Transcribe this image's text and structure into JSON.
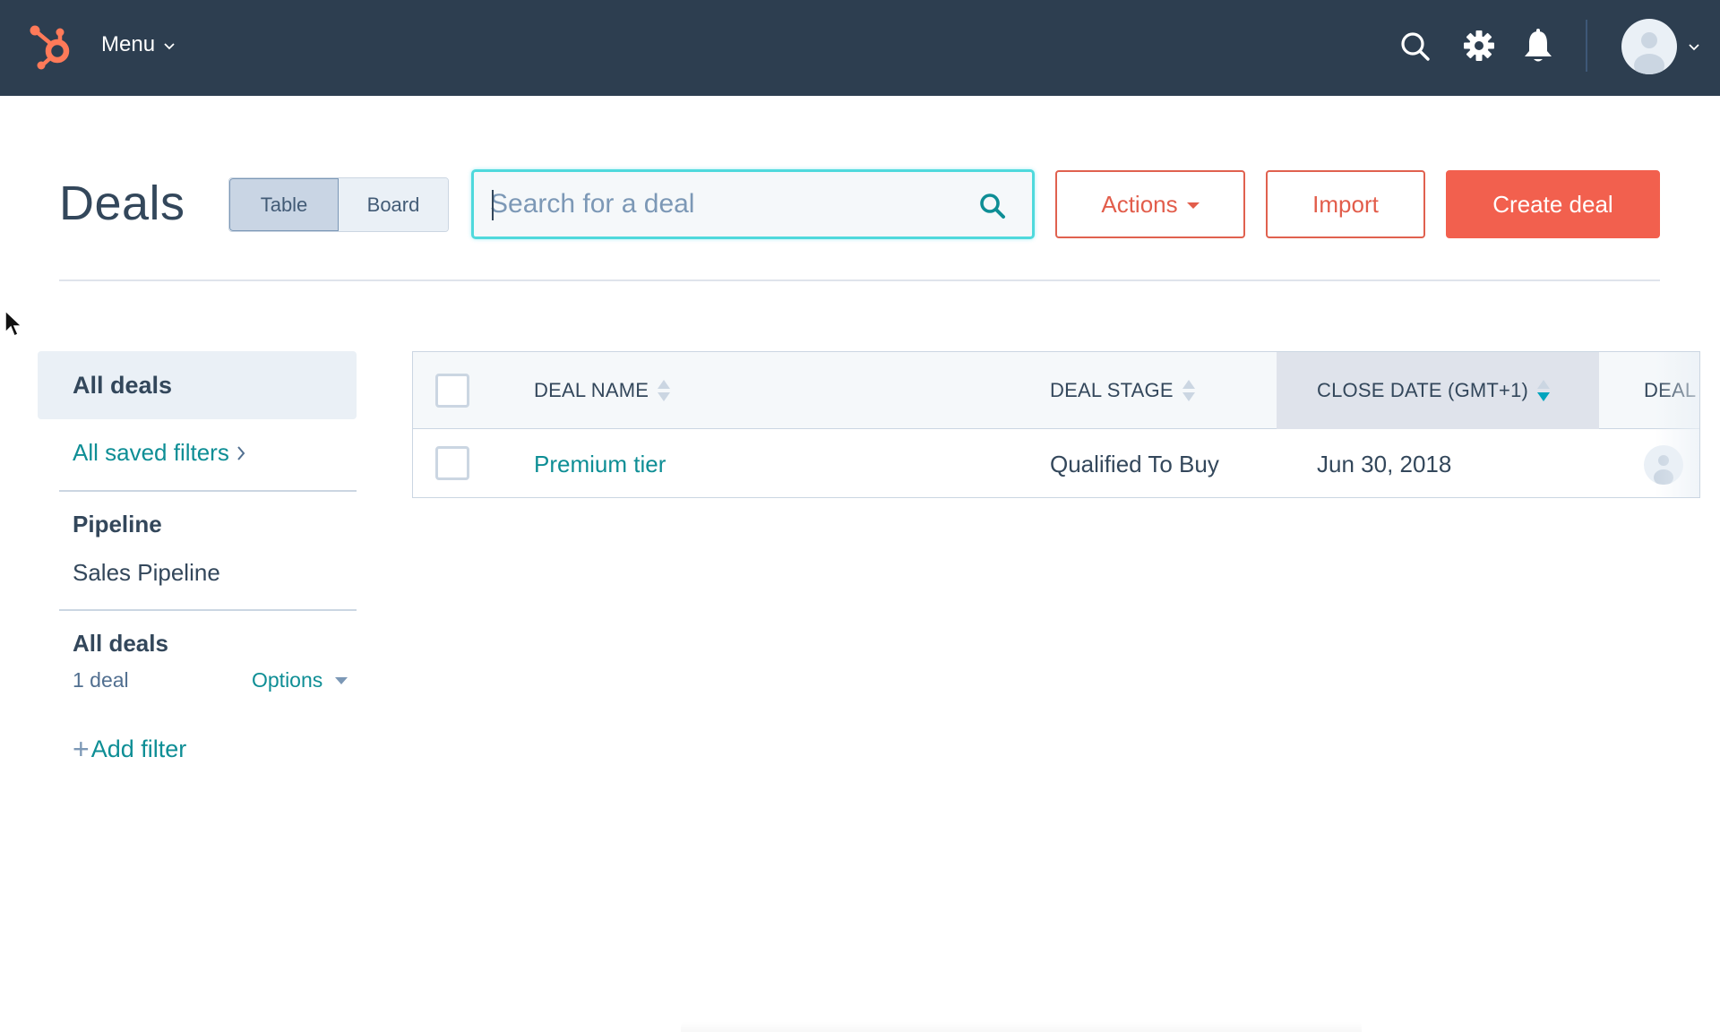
{
  "nav": {
    "logo_icon": "hubspot-sprocket-icon",
    "menu_label": "Menu",
    "icons": [
      "search-icon",
      "gear-icon",
      "bell-icon"
    ],
    "avatar_icon": "user-avatar-icon",
    "brand_color": "#ff7a59",
    "bg_color": "#2d3e50"
  },
  "page": {
    "title": "Deals",
    "view_toggle": [
      {
        "label": "Table",
        "active": true
      },
      {
        "label": "Board",
        "active": false
      }
    ],
    "search": {
      "placeholder": "Search for a deal",
      "value": ""
    },
    "buttons": {
      "actions": "Actions",
      "import": "Import",
      "create": "Create deal"
    },
    "accent_color": "#f2604e",
    "link_color": "#0e8e95"
  },
  "sidebar": {
    "active_view": "All deals",
    "saved_filters": "All saved filters",
    "pipeline_label": "Pipeline",
    "pipeline_value": "Sales Pipeline",
    "current_view_label": "All deals",
    "deal_count": "1 deal",
    "options_label": "Options",
    "add_filter": "Add filter",
    "add_filter_prefix": "+"
  },
  "table": {
    "columns": [
      {
        "label": "DEAL NAME",
        "sort": "none"
      },
      {
        "label": "DEAL STAGE",
        "sort": "none"
      },
      {
        "label": "CLOSE DATE (GMT+1)",
        "sort": "descending"
      },
      {
        "label": "DEAL",
        "sort": "none"
      }
    ],
    "rows": [
      {
        "deal_name": "Premium tier",
        "deal_stage": "Qualified To Buy",
        "close_date": "Jun 30, 2018",
        "owner_icon": "user-avatar-icon"
      }
    ]
  }
}
